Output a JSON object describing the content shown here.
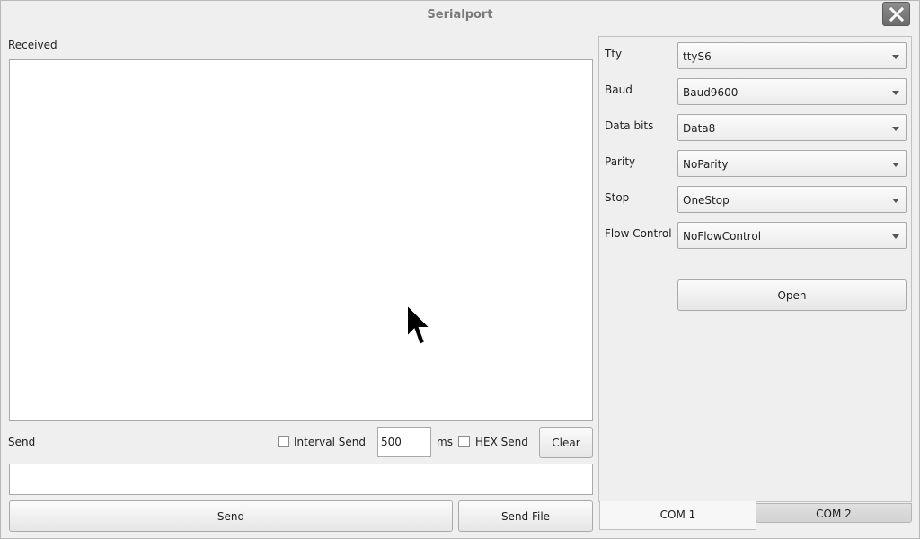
{
  "window": {
    "title": "Serialport"
  },
  "received": {
    "label": "Received",
    "content": ""
  },
  "send": {
    "label": "Send",
    "interval_send_label": "Interval Send",
    "interval_value": "500",
    "interval_unit": "ms",
    "hex_send_label": "HEX Send",
    "clear_label": "Clear",
    "input_value": "",
    "send_button": "Send",
    "send_file_button": "Send File"
  },
  "settings": {
    "tty": {
      "label": "Tty",
      "value": "ttyS6"
    },
    "baud": {
      "label": "Baud",
      "value": "Baud9600"
    },
    "data_bits": {
      "label": "Data bits",
      "value": "Data8"
    },
    "parity": {
      "label": "Parity",
      "value": "NoParity"
    },
    "stop": {
      "label": "Stop",
      "value": "OneStop"
    },
    "flow_control": {
      "label": "Flow Control",
      "value": "NoFlowControl"
    },
    "open_button": "Open"
  },
  "tabs": [
    {
      "label": "COM 1",
      "active": true
    },
    {
      "label": "COM 2",
      "active": false
    }
  ],
  "icons": {
    "close": "close-icon",
    "dropdown": "chevron-down-icon",
    "cursor": "mouse-pointer-icon"
  }
}
